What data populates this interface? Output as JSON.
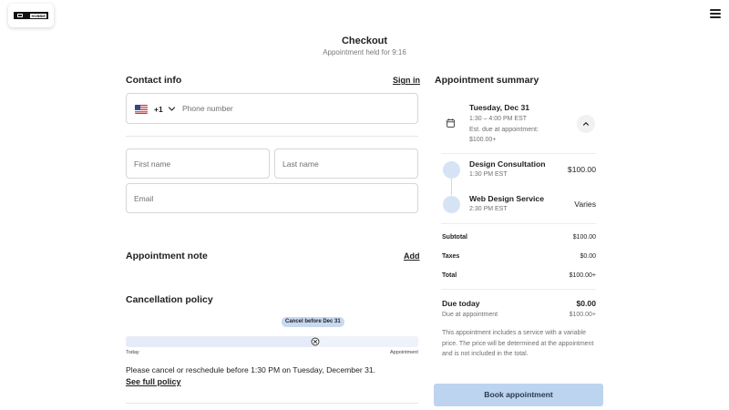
{
  "header": {
    "logo_text": "HOBBIE",
    "title": "Checkout",
    "subtitle": "Appointment held for 9:16"
  },
  "contact": {
    "heading": "Contact info",
    "sign_in": "Sign in",
    "country_code": "+1",
    "phone_placeholder": "Phone number",
    "first_name_placeholder": "First name",
    "last_name_placeholder": "Last name",
    "email_placeholder": "Email"
  },
  "note": {
    "heading": "Appointment note",
    "add_label": "Add"
  },
  "cancellation": {
    "heading": "Cancellation policy",
    "badge": "Cancel before Dec 31",
    "today_label": "Today",
    "appointment_label": "Appointment",
    "progress_fraction": 0.65,
    "policy_text": "Please cancel or reschedule before 1:30 PM on Tuesday, December 31.",
    "full_policy_link": "See full policy"
  },
  "summary": {
    "heading": "Appointment summary",
    "date": "Tuesday, Dec 31",
    "time_range": "1:30 – 4:00 PM EST",
    "est_due_line1": "Est. due at appointment:",
    "est_due_line2": "$100.00+",
    "services": [
      {
        "name": "Design Consultation",
        "time": "1:30 PM EST",
        "price": "$100.00"
      },
      {
        "name": "Web Design Service",
        "time": "2:30 PM EST",
        "price": "Varies"
      }
    ],
    "subtotal_label": "Subtotal",
    "subtotal_value": "$100.00",
    "taxes_label": "Taxes",
    "taxes_value": "$0.00",
    "total_label": "Total",
    "total_value": "$100.00+",
    "due_today_label": "Due today",
    "due_today_value": "$0.00",
    "due_at_appt_label": "Due at appointment",
    "due_at_appt_value": "$100.00+",
    "note": "This appointment includes a service with a variable price. The price will be determined at the appointment and is not included in the total."
  },
  "book_button": "Book appointment",
  "colors": {
    "accent": "#bcd4ef",
    "service_dot": "#d6e3f5",
    "badge": "#c8d9f0"
  }
}
